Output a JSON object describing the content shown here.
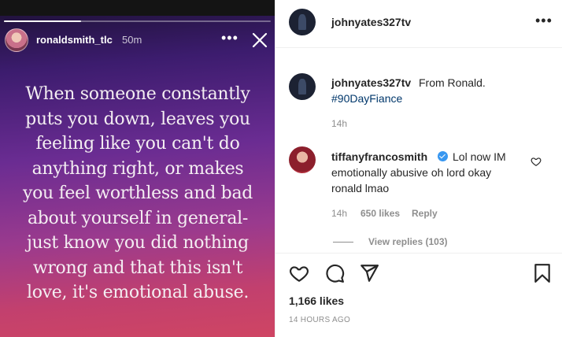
{
  "story": {
    "username": "ronaldsmith_tlc",
    "time": "50m",
    "more_label": "•••",
    "progress": 0.29,
    "quote_lines": [
      "When someone constantly",
      "puts you down, leaves you",
      "feeling like you can't do",
      "anything right, or makes",
      "you feel worthless and bad",
      "about yourself in general-",
      "just know you did nothing",
      "wrong and that this isn't",
      "love, it's emotional abuse."
    ]
  },
  "post": {
    "header": {
      "username": "johnyates327tv",
      "more_label": "•••"
    },
    "caption": {
      "username": "johnyates327tv",
      "text": "From Ronald.",
      "hashtag": "#90DayFiance",
      "time": "14h"
    },
    "comment": {
      "username": "tiffanyfrancosmith",
      "text_line1": "Lol now IM",
      "text_line2": "emotionally abusive oh lord okay",
      "text_line3": "ronald lmao",
      "time": "14h",
      "likes": "650 likes",
      "reply_label": "Reply",
      "view_replies": "View replies (103)"
    },
    "likes_count": "1,166 likes",
    "timestamp": "14 HOURS AGO"
  },
  "icons": {
    "story_close": "close-icon",
    "heart": "heart-icon",
    "comment": "comment-icon",
    "share": "share-icon",
    "save": "bookmark-icon",
    "verified": "verified-badge-icon"
  }
}
